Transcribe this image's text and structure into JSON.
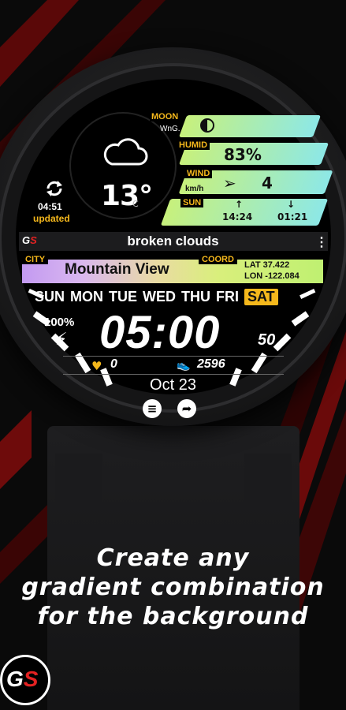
{
  "weather": {
    "temperature": "13°",
    "unit": "C",
    "condition": "broken clouds",
    "update_time": "04:51",
    "update_label": "updated"
  },
  "moon": {
    "label": "MOON",
    "phase": "WnG."
  },
  "humidity": {
    "label": "HUMID",
    "value": "83%"
  },
  "wind": {
    "label": "WIND",
    "unit": "km/h",
    "value": "4"
  },
  "sun": {
    "label": "SUN",
    "rise": "14:24",
    "set": "01:21"
  },
  "location": {
    "city_label": "CITY",
    "city": "Mountain View",
    "coord_label": "COORD",
    "lat": "LAT  37.422",
    "lon": "LON  -122.084"
  },
  "days": [
    "SUN",
    "MON",
    "TUE",
    "WED",
    "THU",
    "FRI",
    "SAT"
  ],
  "active_day": "SAT",
  "battery": "100%",
  "time": {
    "hm": "05:00",
    "seconds": "50"
  },
  "heart_rate": "0",
  "steps": "2596",
  "date": "Oct 23",
  "promo": {
    "line1": "Create any",
    "line2": "gradient combination",
    "line3": "for the background"
  },
  "brand": {
    "logo_g": "G",
    "logo_s": "S"
  },
  "colors": {
    "accent": "#f5b81c",
    "brand_red": "#e32222"
  }
}
